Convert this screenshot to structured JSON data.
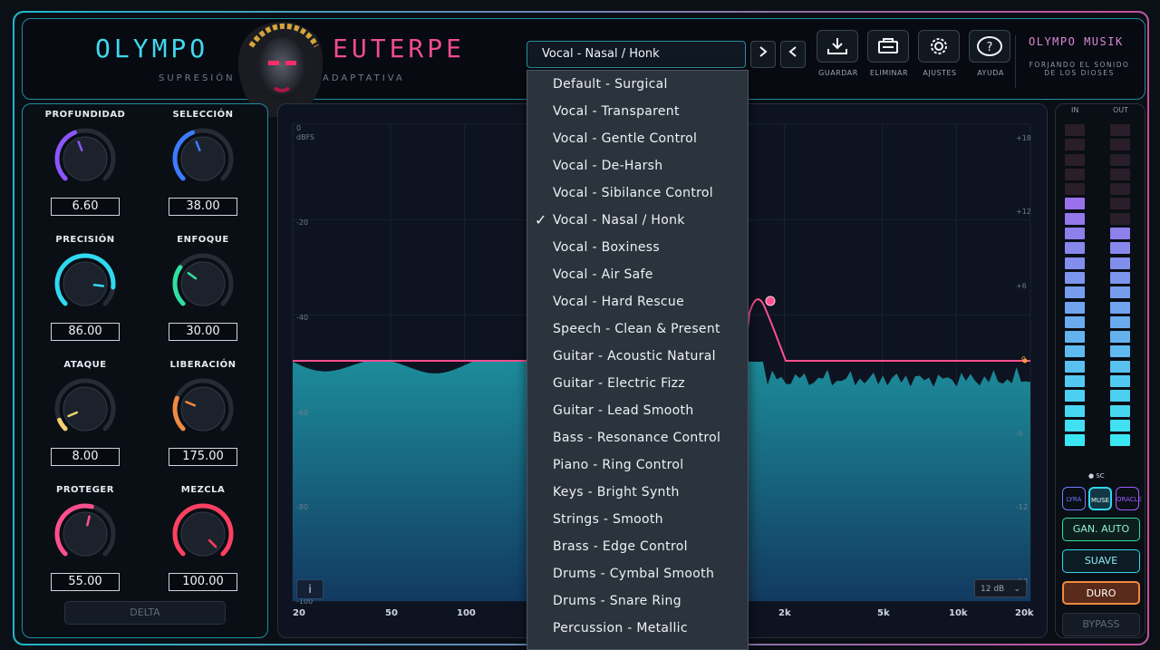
{
  "header": {
    "brand_left": "OLYMPO",
    "brand_right": "EUTERPE",
    "subtitle": "SUPRESIÓN ESPECTRAL ADAPTATIVA",
    "preset_selected": "Vocal - Nasal / Honk",
    "next_icon": "chevron-right-icon",
    "prev_icon": "chevron-left-icon",
    "tools": [
      {
        "label": "GUARDAR",
        "icon": "download-icon"
      },
      {
        "label": "ELIMINAR",
        "icon": "trash-icon"
      },
      {
        "label": "AJUSTES",
        "icon": "gear-icon"
      },
      {
        "label": "AYUDA",
        "icon": "help-icon"
      }
    ],
    "maker": "OLYMPO MUSIK",
    "tagline_1": "FORJANDO EL SONIDO",
    "tagline_2": "DE LOS DIOSES"
  },
  "knobs": [
    {
      "label": "PROFUNDIDAD",
      "value": "6.60",
      "color": "#8b55ff",
      "level": 0.42
    },
    {
      "label": "SELECCIÓN",
      "value": "38.00",
      "color": "#3c7bff",
      "level": 0.42
    },
    {
      "label": "PRECISIÓN",
      "value": "86.00",
      "color": "#2fd9f0",
      "level": 0.86
    },
    {
      "label": "ENFOQUE",
      "value": "30.00",
      "color": "#2fe0a0",
      "level": 0.3
    },
    {
      "label": "ATAQUE",
      "value": "8.00",
      "color": "#f0d070",
      "level": 0.08
    },
    {
      "label": "LIBERACIÓN",
      "value": "175.00",
      "color": "#f08a40",
      "level": 0.25
    },
    {
      "label": "PROTEGER",
      "value": "55.00",
      "color": "#ff4f8f",
      "level": 0.55
    },
    {
      "label": "MEZCLA",
      "value": "100.00",
      "color": "#ff4060",
      "level": 1.0
    }
  ],
  "delta_label": "DELTA",
  "analyzer": {
    "unit": "dBFS",
    "y_left": [
      "0",
      "-20",
      "-40",
      "-60",
      "-80",
      "-100"
    ],
    "y_right": [
      "+18",
      "+12",
      "+6",
      "0",
      "-6",
      "-12",
      "-18"
    ],
    "x_labels": [
      "20",
      "50",
      "100",
      "2k",
      "5k",
      "10k",
      "20k"
    ],
    "info_label": "i",
    "zoom_label": "12 dB",
    "accent_color": "#ff4f8f",
    "fill_color": "#1d8c9a"
  },
  "dropdown": {
    "items": [
      "Default - Surgical",
      "Vocal - Transparent",
      "Vocal - Gentle Control",
      "Vocal - De-Harsh",
      "Vocal - Sibilance Control",
      "Vocal - Nasal / Honk",
      "Vocal - Boxiness",
      "Vocal - Air Safe",
      "Vocal - Hard Rescue",
      "Speech - Clean & Present",
      "Guitar - Acoustic Natural",
      "Guitar - Electric Fizz",
      "Guitar - Lead Smooth",
      "Bass - Resonance Control",
      "Piano - Ring Control",
      "Keys - Bright Synth",
      "Strings - Smooth",
      "Brass - Edge Control",
      "Drums - Cymbal Smooth",
      "Drums - Snare Ring",
      "Percussion - Metallic"
    ],
    "checked_index": 5,
    "check_mark": "✓"
  },
  "meters": {
    "in_label": "IN",
    "out_label": "OUT",
    "sc_label": "SC",
    "in_level": 0.75,
    "out_level": 0.7,
    "modes": [
      {
        "label": "LYRA",
        "color": "#6c7cff"
      },
      {
        "label": "MUSE",
        "color": "#2fd9f0"
      },
      {
        "label": "ORACLE",
        "color": "#9b5cff"
      }
    ],
    "buttons": [
      {
        "label": "GAN. AUTO",
        "color": "#2fe0a0"
      },
      {
        "label": "SUAVE",
        "color": "#2fd9f0"
      },
      {
        "label": "DURO",
        "color": "#f08a40"
      },
      {
        "label": "BYPASS",
        "color": "#5f6b7a"
      }
    ]
  }
}
